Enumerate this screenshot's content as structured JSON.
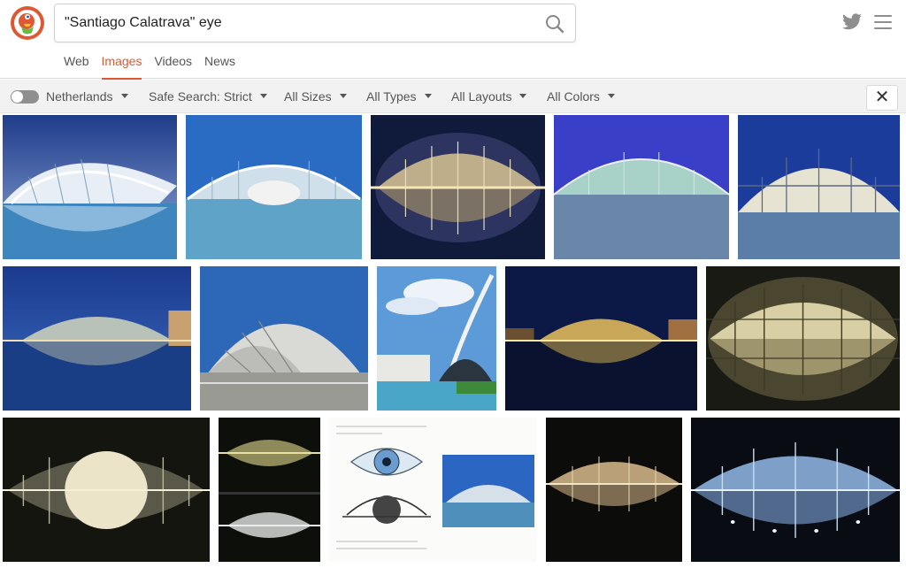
{
  "search": {
    "query": "\"Santiago Calatrava\" eye",
    "button_icon": "magnifier-icon"
  },
  "header": {
    "logo": "duckduckgo-logo",
    "twitter_icon": "twitter-icon",
    "menu_icon": "hamburger-menu-icon"
  },
  "tabs": [
    {
      "label": "Web",
      "active": false
    },
    {
      "label": "Images",
      "active": true
    },
    {
      "label": "Videos",
      "active": false
    },
    {
      "label": "News",
      "active": false
    }
  ],
  "filters": {
    "region_toggle_on": false,
    "region": "Netherlands",
    "safe_search": "Safe Search: Strict",
    "size": "All Sizes",
    "type": "All Types",
    "layout": "All Layouts",
    "color": "All Colors",
    "close_label": "✕"
  },
  "colors": {
    "accent": "#de5833",
    "filter_bar_bg": "#f2f2f2",
    "toggle_off": "#8f8f8f"
  },
  "results": [
    {
      "subject": "hemisferic-side-day",
      "style": "day"
    },
    {
      "subject": "hemisferic-front-day",
      "style": "day"
    },
    {
      "subject": "hemisferic-night-reflection",
      "style": "night"
    },
    {
      "subject": "hemisferic-wide-day",
      "style": "day"
    },
    {
      "subject": "hemisferic-closeup-day",
      "style": "day"
    },
    {
      "subject": "hemisferic-dusk-reflection",
      "style": "dusk"
    },
    {
      "subject": "hemisferic-shell-white",
      "style": "white"
    },
    {
      "subject": "agora-and-bridge-sky",
      "style": "sky"
    },
    {
      "subject": "hemisferic-night-city",
      "style": "night"
    },
    {
      "subject": "hemisferic-night-close",
      "style": "night"
    },
    {
      "subject": "hemisferic-night-globe",
      "style": "night"
    },
    {
      "subject": "hemisferic-night-pair",
      "style": "night"
    },
    {
      "subject": "eye-sketch-collage",
      "style": "sketch"
    },
    {
      "subject": "hemisferic-night-front",
      "style": "night"
    },
    {
      "subject": "hemisferic-night-blue",
      "style": "nightblue"
    }
  ]
}
